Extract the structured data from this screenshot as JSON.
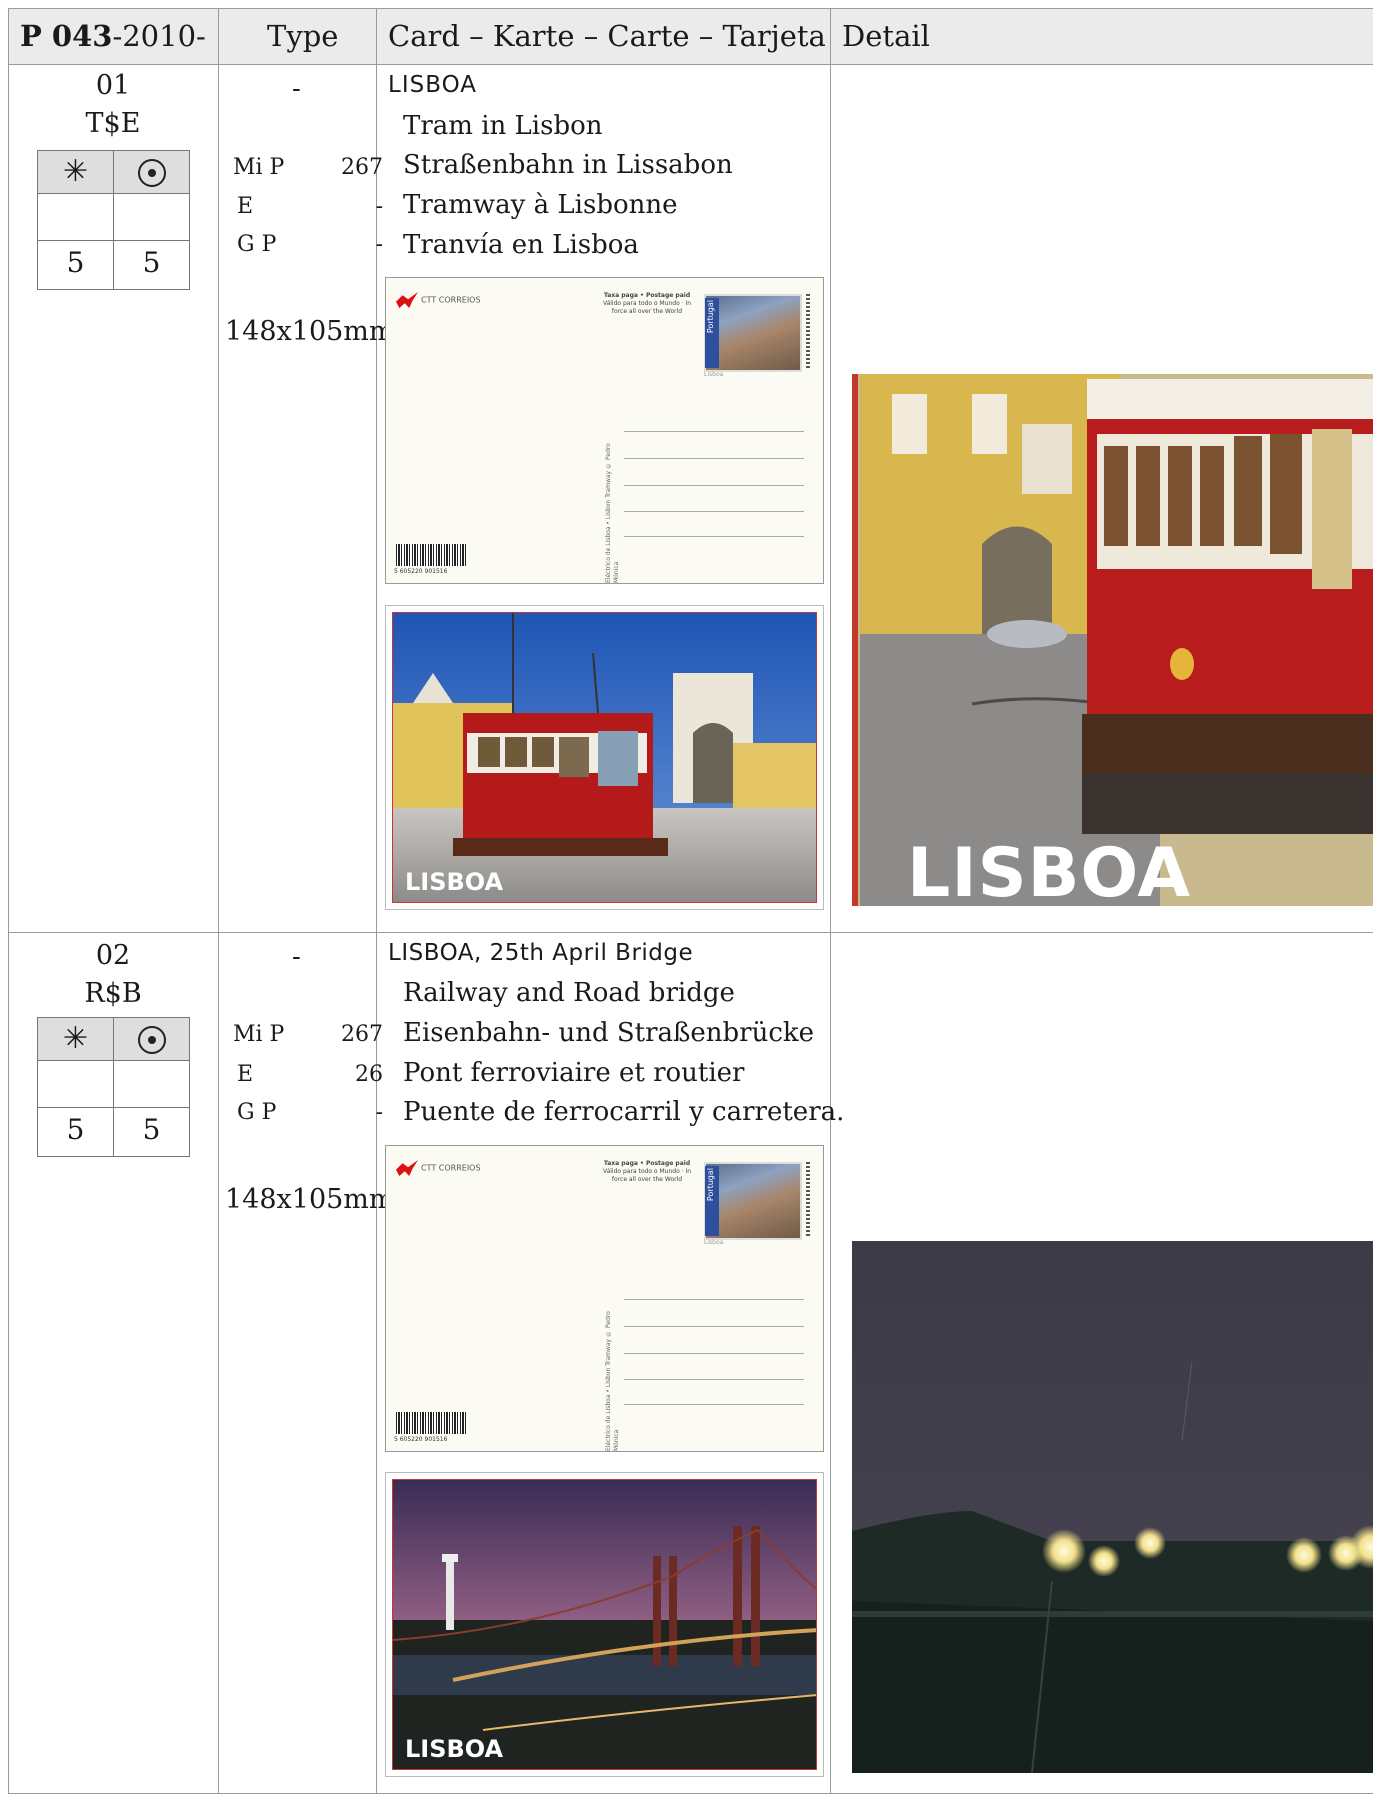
{
  "header": {
    "catalog_prefix": "P 043",
    "catalog_suffix": "-2010-",
    "type_col": "Type",
    "card_col": "Card – Karte – Carte – Tarjeta",
    "detail_col": "Detail"
  },
  "rows": [
    {
      "number": "01",
      "code": "T$E",
      "mint_icon": "asterisk-icon",
      "used_icon": "circled-dot-icon",
      "mint_value": "5",
      "used_value": "5",
      "type_value": "-",
      "catalog": [
        {
          "label": "Mi  P",
          "value": "267"
        },
        {
          "label": "E",
          "value": "-"
        },
        {
          "label": "G  P",
          "value": "-"
        }
      ],
      "size": "148x105mm",
      "title": "LISBOA",
      "lines": [
        "Tram in Lisbon",
        "Straßenbahn in Lissabon",
        "Tramway à Lisbonne",
        "Tranvía en Lisboa"
      ],
      "picture_label": "LISBOA",
      "detail_label": "LISBOA"
    },
    {
      "number": "02",
      "code": "R$B",
      "mint_icon": "asterisk-icon",
      "used_icon": "circled-dot-icon",
      "mint_value": "5",
      "used_value": "5",
      "type_value": "-",
      "catalog": [
        {
          "label": "Mi  P",
          "value": "267"
        },
        {
          "label": "E",
          "value": "26"
        },
        {
          "label": "G  P",
          "value": "-"
        }
      ],
      "size": "148x105mm",
      "title": "LISBOA, 25th April Bridge",
      "lines": [
        "Railway and Road bridge",
        "Eisenbahn- und Straßenbrücke",
        "Pont ferroviaire et routier",
        "Puente de ferrocarril y carretera."
      ],
      "picture_label": "LISBOA"
    }
  ],
  "postcard_front": {
    "logo_text": "CTT CORREIOS",
    "postage_text": "Taxa paga • Postage paid",
    "postage_sub": "Válido para todo o Mundo · In force all over the World",
    "stamp_country": "Portugal",
    "stamp_caption": "Lisboa",
    "vertical_credit": "Eléctrico de Lisboa • Lisbon Tramway  © Pedro Mónica",
    "barcode_number": "5 605220 901516"
  },
  "colors": {
    "header_bg": "#ebebeb",
    "tram_red": "#b81c1c",
    "sky_blue": "#2d5fae"
  }
}
